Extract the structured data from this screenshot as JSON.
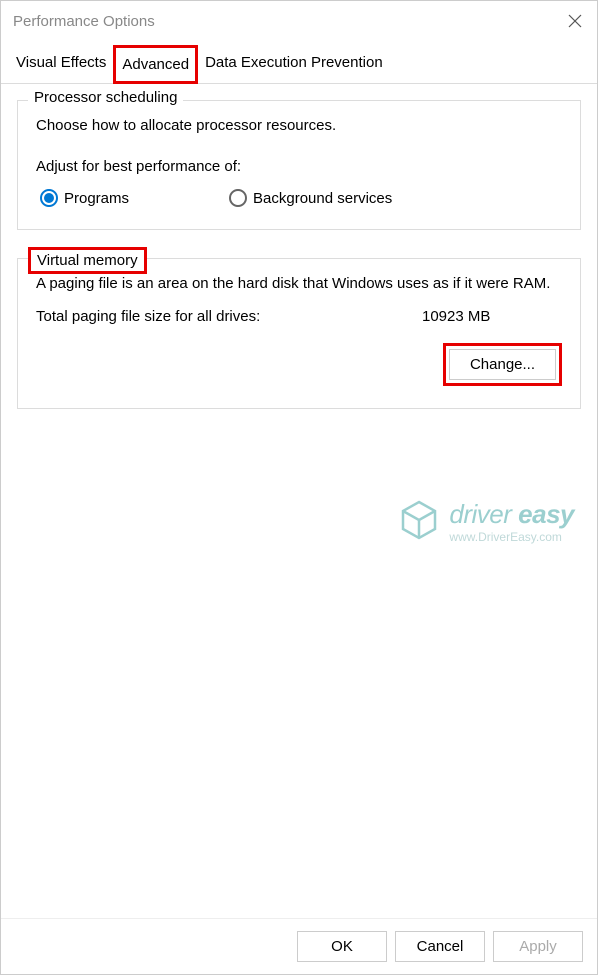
{
  "window": {
    "title": "Performance Options"
  },
  "tabs": {
    "visual_effects": "Visual Effects",
    "advanced": "Advanced",
    "dep": "Data Execution Prevention"
  },
  "processor": {
    "legend": "Processor scheduling",
    "description": "Choose how to allocate processor resources.",
    "adjust_label": "Adjust for best performance of:",
    "option_programs": "Programs",
    "option_background": "Background services"
  },
  "virtual_memory": {
    "legend": "Virtual memory",
    "description": "A paging file is an area on the hard disk that Windows uses as if it were RAM.",
    "size_label": "Total paging file size for all drives:",
    "size_value": "10923 MB",
    "change_button": "Change..."
  },
  "footer": {
    "ok": "OK",
    "cancel": "Cancel",
    "apply": "Apply"
  },
  "watermark": {
    "brand_prefix": "driver ",
    "brand_suffix": "easy",
    "url": "www.DriverEasy.com"
  }
}
